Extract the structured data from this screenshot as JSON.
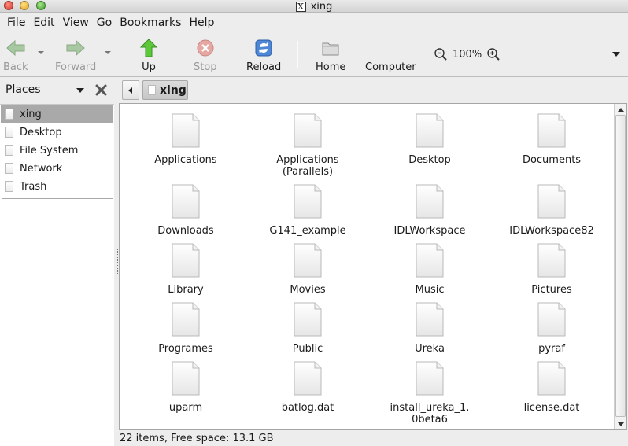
{
  "window": {
    "title": "xing"
  },
  "menubar": [
    "File",
    "Edit",
    "View",
    "Go",
    "Bookmarks",
    "Help"
  ],
  "toolbar": {
    "back": "Back",
    "forward": "Forward",
    "up": "Up",
    "stop": "Stop",
    "reload": "Reload",
    "home": "Home",
    "computer": "Computer",
    "zoom": "100%"
  },
  "sidebar": {
    "title": "Places",
    "items": [
      "xing",
      "Desktop",
      "File System",
      "Network",
      "Trash"
    ]
  },
  "pathbar": {
    "current": "xing"
  },
  "files": [
    "Applications",
    "Applications\n(Parallels)",
    "Desktop",
    "Documents",
    "Downloads",
    "G141_example",
    "IDLWorkspace",
    "IDLWorkspace82",
    "Library",
    "Movies",
    "Music",
    "Pictures",
    "Programes",
    "Public",
    "Ureka",
    "pyraf",
    "uparm",
    "batlog.dat",
    "install_ureka_1.\n0beta6",
    "license.dat"
  ],
  "status": "22 items, Free space: 13.1 GB"
}
